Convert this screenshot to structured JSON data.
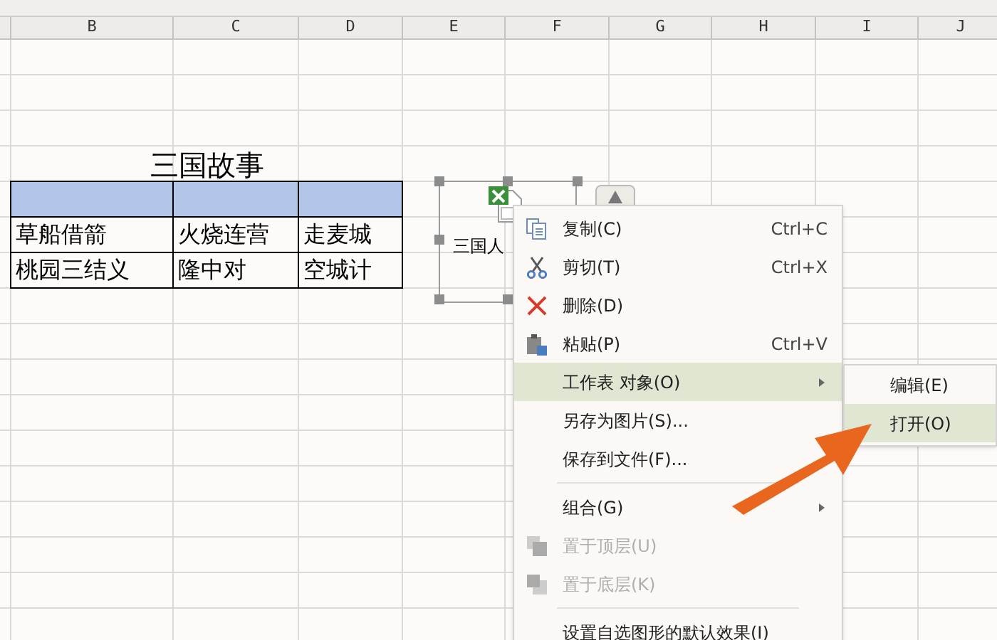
{
  "columns": [
    "B",
    "C",
    "D",
    "E",
    "F",
    "G",
    "H",
    "I",
    "J"
  ],
  "sheet": {
    "title": "三国故事",
    "rows": [
      [
        "草船借箭",
        "火烧连营",
        "走麦城"
      ],
      [
        "桃园三结义",
        "隆中对",
        "空城计"
      ]
    ]
  },
  "embedded_object": {
    "label": "三国人"
  },
  "context_menu": [
    {
      "kind": "item",
      "label": "复制(C)",
      "shortcut": "Ctrl+C",
      "disabled": false,
      "selected": false
    },
    {
      "kind": "item",
      "label": "剪切(T)",
      "shortcut": "Ctrl+X",
      "disabled": false,
      "selected": false
    },
    {
      "kind": "item",
      "label": "删除(D)",
      "disabled": false,
      "selected": false
    },
    {
      "kind": "item",
      "label": "粘贴(P)",
      "shortcut": "Ctrl+V",
      "disabled": false,
      "selected": false
    },
    {
      "kind": "submenu",
      "label": "工作表 对象(O)",
      "disabled": false,
      "selected": true
    },
    {
      "kind": "item",
      "label": "另存为图片(S)...",
      "disabled": false,
      "selected": false
    },
    {
      "kind": "item",
      "label": "保存到文件(F)...",
      "disabled": false,
      "selected": false
    },
    {
      "kind": "separator"
    },
    {
      "kind": "submenu",
      "label": "组合(G)",
      "disabled": false,
      "selected": false
    },
    {
      "kind": "item",
      "label": "置于顶层(U)",
      "disabled": true,
      "selected": false
    },
    {
      "kind": "item",
      "label": "置于底层(K)",
      "disabled": true,
      "selected": false
    },
    {
      "kind": "separator"
    },
    {
      "kind": "item",
      "label": "设置自选图形的默认效果(I)",
      "disabled": false,
      "selected": false
    }
  ],
  "submenu": [
    {
      "label": "编辑(E)",
      "selected": false
    },
    {
      "label": "打开(O)",
      "selected": true
    }
  ]
}
